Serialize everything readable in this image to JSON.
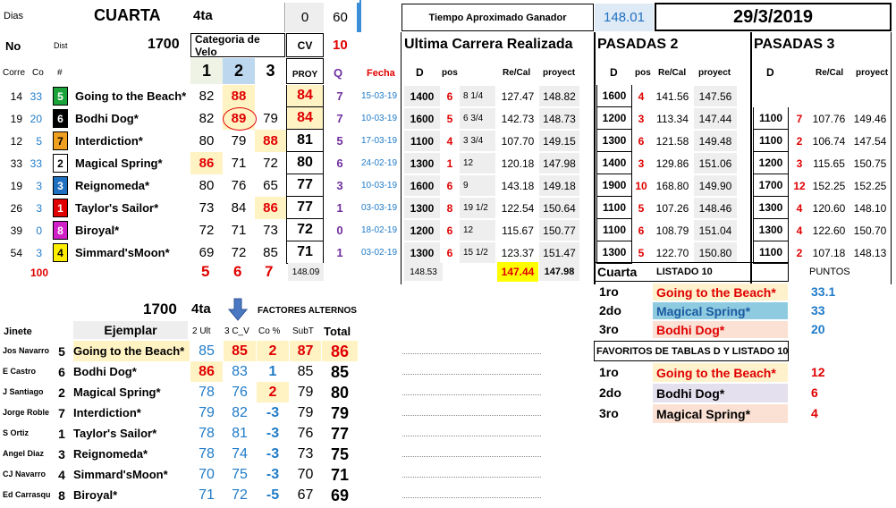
{
  "header": {
    "dias_label": "Dias",
    "race_name": "CUARTA",
    "race_short": "4ta",
    "dias_a": "0",
    "dias_b": "60",
    "tiempo_label": "Tiempo Aproximado Ganador",
    "tiempo_value": "148.01",
    "date": "29/3/2019",
    "no_label": "No",
    "dist_label": "Dist",
    "distance": "1700",
    "categoria_label": "Categoria de Velo",
    "cv_label": "CV",
    "cv_value": "10",
    "ultima_label": "Ultima Carrera Realizada",
    "pasadas2_label": "PASADAS 2",
    "pasadas3_label": "PASADAS 3"
  },
  "columns": {
    "corre": "Corre",
    "co": "Co",
    "num": "#",
    "c1": "1",
    "c2": "2",
    "c3": "3",
    "proy": "PROY",
    "q": "Q",
    "fecha": "Fecha",
    "d": "D",
    "pos": "pos",
    "recal": "Re/Cal",
    "proyect": "proyect"
  },
  "main_rows": [
    {
      "corre": "14",
      "co": "33",
      "num": "5",
      "num_bg": "#1aa33a",
      "num_fg": "#ffffff",
      "name": "Going to the Beach*",
      "v1": "82",
      "v2": "88",
      "v3": "",
      "proy": "84",
      "q": "7",
      "fecha": "15-03-19",
      "d": "1400",
      "pos": "6",
      "margin": "8 1/4",
      "recal": "127.47",
      "proyect": "148.82",
      "p2d": "1600",
      "p2pos": "4",
      "p2recal": "141.56",
      "p2proy": "147.56",
      "p3d": "",
      "p3pos": "",
      "p3recal": "",
      "p3proy": ""
    },
    {
      "corre": "19",
      "co": "20",
      "num": "6",
      "num_bg": "#000000",
      "num_fg": "#ffffff",
      "name": "Bodhi Dog*",
      "v1": "82",
      "v2": "89",
      "v3": "79",
      "proy": "84",
      "q": "7",
      "fecha": "10-03-19",
      "d": "1600",
      "pos": "5",
      "margin": "6 3/4",
      "recal": "142.73",
      "proyect": "148.73",
      "p2d": "1200",
      "p2pos": "3",
      "p2recal": "113.34",
      "p2proy": "147.44",
      "p3d": "1100",
      "p3pos": "7",
      "p3recal": "107.76",
      "p3proy": "149.46"
    },
    {
      "corre": "12",
      "co": "5",
      "num": "7",
      "num_bg": "#f0a020",
      "num_fg": "#000000",
      "name": "Interdiction*",
      "v1": "80",
      "v2": "79",
      "v3": "88",
      "proy": "81",
      "q": "5",
      "fecha": "17-03-19",
      "d": "1100",
      "pos": "4",
      "margin": "3 3/4",
      "recal": "107.70",
      "proyect": "149.15",
      "p2d": "1300",
      "p2pos": "6",
      "p2recal": "121.58",
      "p2proy": "149.48",
      "p3d": "1100",
      "p3pos": "2",
      "p3recal": "106.74",
      "p3proy": "147.54"
    },
    {
      "corre": "33",
      "co": "33",
      "num": "2",
      "num_bg": "#ffffff",
      "num_fg": "#000000",
      "name": "Magical Spring*",
      "v1": "86",
      "v2": "71",
      "v3": "72",
      "proy": "80",
      "q": "6",
      "fecha": "24-02-19",
      "d": "1300",
      "pos": "1",
      "margin": "12",
      "recal": "120.18",
      "proyect": "147.98",
      "p2d": "1400",
      "p2pos": "3",
      "p2recal": "129.86",
      "p2proy": "151.06",
      "p3d": "1200",
      "p3pos": "3",
      "p3recal": "115.65",
      "p3proy": "150.75"
    },
    {
      "corre": "19",
      "co": "3",
      "num": "3",
      "num_bg": "#1f6fc0",
      "num_fg": "#ffffff",
      "name": "Reignomeda*",
      "v1": "80",
      "v2": "76",
      "v3": "65",
      "proy": "77",
      "q": "3",
      "fecha": "10-03-19",
      "d": "1600",
      "pos": "6",
      "margin": "9",
      "recal": "143.18",
      "proyect": "149.18",
      "p2d": "1900",
      "p2pos": "10",
      "p2recal": "168.80",
      "p2proy": "149.90",
      "p3d": "1700",
      "p3pos": "12",
      "p3recal": "152.25",
      "p3proy": "152.25"
    },
    {
      "corre": "26",
      "co": "3",
      "num": "1",
      "num_bg": "#e00000",
      "num_fg": "#ffffff",
      "name": "Taylor's Sailor*",
      "v1": "73",
      "v2": "84",
      "v3": "86",
      "proy": "77",
      "q": "1",
      "fecha": "03-03-19",
      "d": "1300",
      "pos": "8",
      "margin": "19 1/2",
      "recal": "122.54",
      "proyect": "150.64",
      "p2d": "1100",
      "p2pos": "5",
      "p2recal": "107.26",
      "p2proy": "148.46",
      "p3d": "1300",
      "p3pos": "4",
      "p3recal": "120.60",
      "p3proy": "148.10"
    },
    {
      "corre": "39",
      "co": "0",
      "num": "8",
      "num_bg": "#d020c8",
      "num_fg": "#ffffff",
      "name": "Biroyal*",
      "v1": "72",
      "v2": "71",
      "v3": "73",
      "proy": "72",
      "q": "0",
      "fecha": "18-02-19",
      "d": "1200",
      "pos": "6",
      "margin": "12",
      "recal": "115.67",
      "proyect": "150.77",
      "p2d": "1100",
      "p2pos": "6",
      "p2recal": "108.79",
      "p2proy": "151.04",
      "p3d": "1300",
      "p3pos": "4",
      "p3recal": "122.60",
      "p3proy": "150.70"
    },
    {
      "corre": "54",
      "co": "3",
      "num": "4",
      "num_bg": "#ffee00",
      "num_fg": "#000000",
      "name": "Simmard'sMoon*",
      "v1": "69",
      "v2": "72",
      "v3": "85",
      "proy": "71",
      "q": "1",
      "fecha": "03-02-19",
      "d": "1300",
      "pos": "6",
      "margin": "15 1/2",
      "recal": "123.37",
      "proyect": "151.47",
      "p2d": "1300",
      "p2pos": "5",
      "p2recal": "122.70",
      "p2proy": "150.80",
      "p3d": "1100",
      "p3pos": "2",
      "p3recal": "107.18",
      "p3proy": "148.13"
    }
  ],
  "totals_row": {
    "label": "100",
    "t1": "5",
    "t2": "6",
    "t3": "7",
    "proy": "148.09",
    "d": "148.53",
    "recal": "147.44",
    "proyect": "147.98"
  },
  "alt": {
    "distance": "1700",
    "race_short": "4ta",
    "title": "FACTORES ALTERNOS",
    "jinete_label": "Jinete",
    "ejemplar_label": "Ejemplar",
    "h_2ult": "2 Ult",
    "h_3cv": "3 C_V",
    "h_co": "Co %",
    "h_subt": "SubT",
    "h_total": "Total",
    "rows": [
      {
        "jinete": "Jos Navarro",
        "num": "5",
        "name": "Going to the Beach*",
        "u2": "85",
        "cv3": "85",
        "co": "2",
        "subt": "87",
        "total": "86"
      },
      {
        "jinete": "E Castro",
        "num": "6",
        "name": "Bodhi Dog*",
        "u2": "86",
        "cv3": "83",
        "co": "1",
        "subt": "85",
        "total": "85"
      },
      {
        "jinete": "J Santiago",
        "num": "2",
        "name": "Magical Spring*",
        "u2": "78",
        "cv3": "76",
        "co": "2",
        "subt": "79",
        "total": "80"
      },
      {
        "jinete": "Jorge Roble",
        "num": "7",
        "name": "Interdiction*",
        "u2": "79",
        "cv3": "82",
        "co": "-3",
        "subt": "79",
        "total": "79"
      },
      {
        "jinete": "S Ortiz",
        "num": "1",
        "name": "Taylor's Sailor*",
        "u2": "78",
        "cv3": "81",
        "co": "-3",
        "subt": "76",
        "total": "77"
      },
      {
        "jinete": "Angel Diaz",
        "num": "3",
        "name": "Reignomeda*",
        "u2": "78",
        "cv3": "74",
        "co": "-3",
        "subt": "73",
        "total": "75"
      },
      {
        "jinete": "CJ Navarro",
        "num": "4",
        "name": "Simmard'sMoon*",
        "u2": "70",
        "cv3": "75",
        "co": "-3",
        "subt": "70",
        "total": "71"
      },
      {
        "jinete": "Ed Carrasqu",
        "num": "8",
        "name": "Biroyal*",
        "u2": "71",
        "cv3": "72",
        "co": "-5",
        "subt": "67",
        "total": "69"
      }
    ]
  },
  "listado": {
    "title_a": "Cuarta",
    "title_b": "LISTADO 10",
    "puntos_label": "PUNTOS",
    "rows": [
      {
        "rank": "1ro",
        "name": "Going to the Beach*",
        "pts": "33.1"
      },
      {
        "rank": "2do",
        "name": "Magical Spring*",
        "pts": "33"
      },
      {
        "rank": "3ro",
        "name": "Bodhi Dog*",
        "pts": "20"
      }
    ]
  },
  "favoritos": {
    "title": "FAVORITOS DE TABLAS D Y LISTADO 10",
    "rows": [
      {
        "rank": "1ro",
        "name": "Going to the Beach*",
        "pts": "12"
      },
      {
        "rank": "2do",
        "name": "Bodhi Dog*",
        "pts": "6"
      },
      {
        "rank": "3ro",
        "name": "Magical Spring*",
        "pts": "4"
      }
    ]
  },
  "icons": {
    "down_arrow": "arrow-down-icon"
  }
}
